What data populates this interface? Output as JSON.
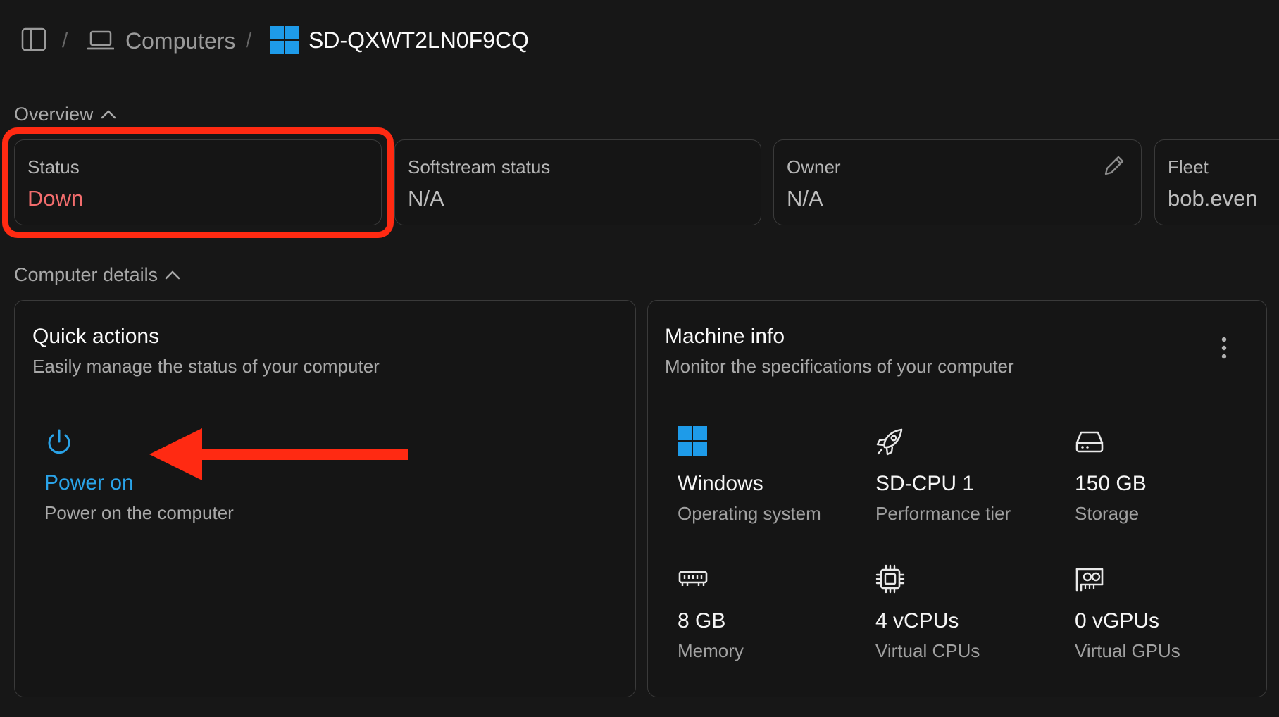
{
  "breadcrumb": {
    "separator": "/",
    "computers_label": "Computers",
    "computer_id": "SD-QXWT2LN0F9CQ"
  },
  "overview": {
    "title": "Overview",
    "cards": [
      {
        "label": "Status",
        "value": "Down"
      },
      {
        "label": "Softstream status",
        "value": "N/A"
      },
      {
        "label": "Owner",
        "value": "N/A"
      },
      {
        "label": "Fleet",
        "value": "bob.even"
      }
    ]
  },
  "details": {
    "title": "Computer details"
  },
  "quick_actions": {
    "title": "Quick actions",
    "subtitle": "Easily manage the status of your computer",
    "power_on_label": "Power on",
    "power_on_desc": "Power on the computer"
  },
  "machine_info": {
    "title": "Machine info",
    "subtitle": "Monitor the specifications of your computer",
    "specs": [
      {
        "icon": "windows-logo-icon",
        "value": "Windows",
        "label": "Operating system"
      },
      {
        "icon": "rocket-icon",
        "value": "SD-CPU 1",
        "label": "Performance tier"
      },
      {
        "icon": "hard-drive-icon",
        "value": "150 GB",
        "label": "Storage"
      },
      {
        "icon": "memory-icon",
        "value": "8 GB",
        "label": "Memory"
      },
      {
        "icon": "cpu-icon",
        "value": "4 vCPUs",
        "label": "Virtual CPUs"
      },
      {
        "icon": "gpu-icon",
        "value": "0 vGPUs",
        "label": "Virtual GPUs"
      }
    ]
  },
  "colors": {
    "background": "#171717",
    "status_down": "#f26d6d",
    "accent_blue": "#2aa3e8",
    "windows_blue": "#1e9be9",
    "annotation_red": "#ff2a12"
  }
}
